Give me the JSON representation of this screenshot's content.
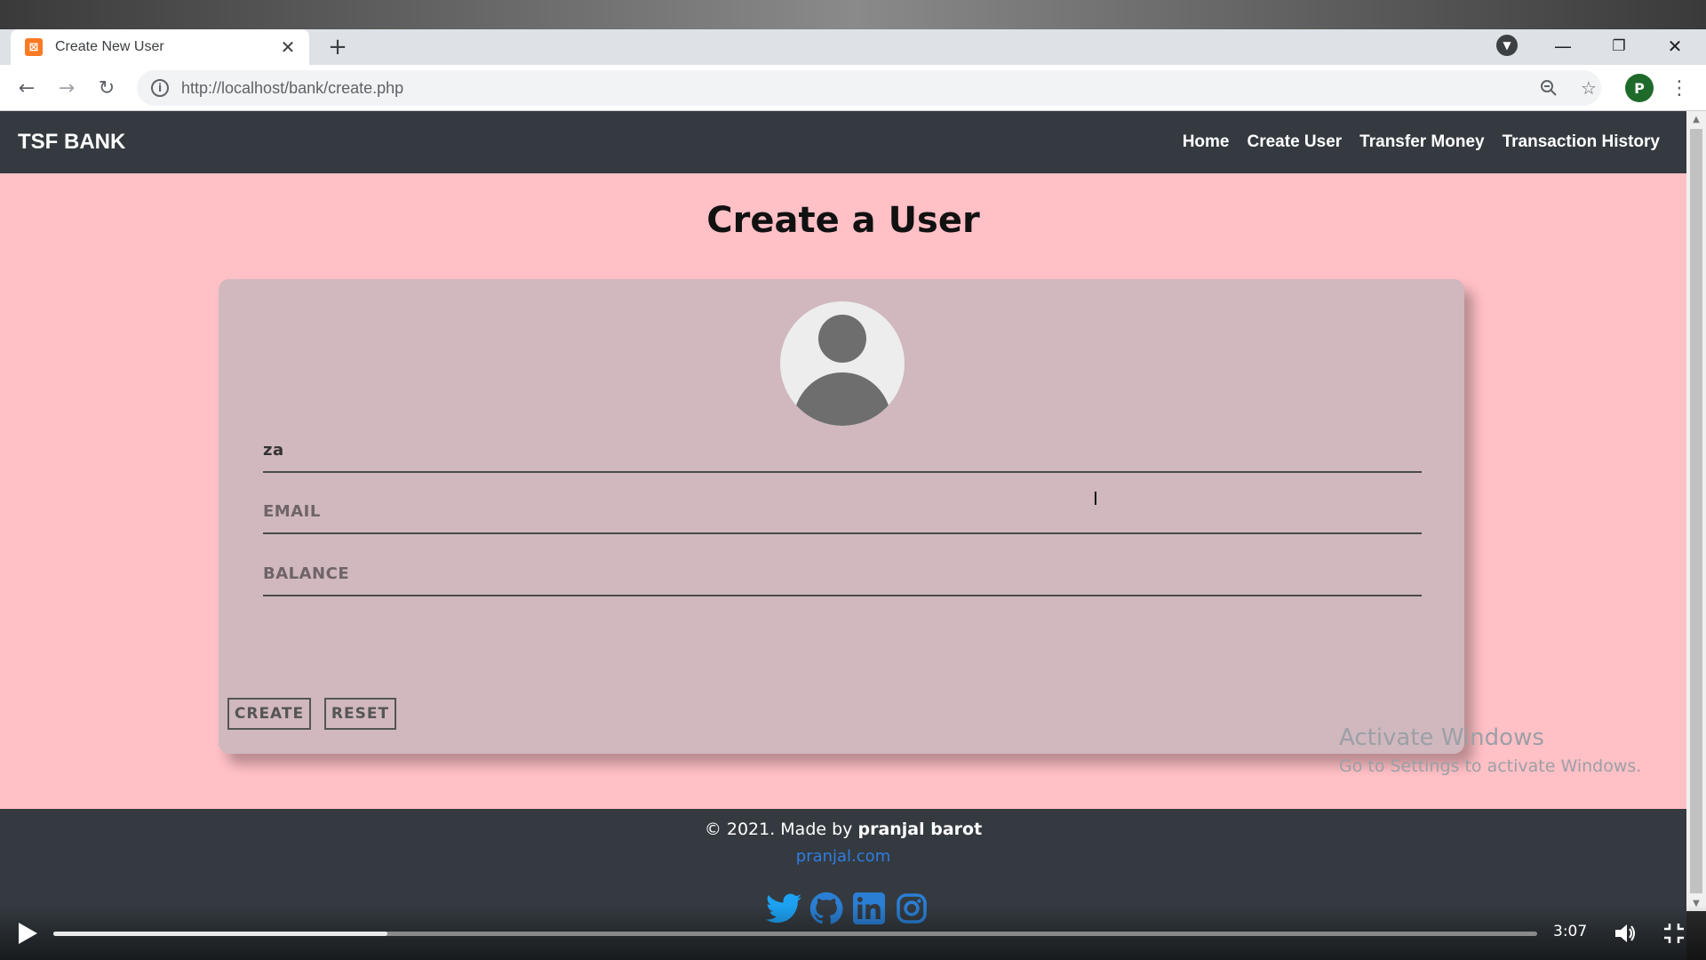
{
  "browser": {
    "tab_title": "Create New User",
    "url": "http://localhost/bank/create.php",
    "profile_initial": "P"
  },
  "navbar": {
    "brand": "TSF BANK",
    "links": [
      "Home",
      "Create User",
      "Transfer Money",
      "Transaction History"
    ]
  },
  "main": {
    "title": "Create a User",
    "form": {
      "name_value": "za",
      "email_placeholder": "EMAIL",
      "balance_placeholder": "BALANCE",
      "create_label": "CREATE",
      "reset_label": "RESET"
    }
  },
  "footer": {
    "copyright_prefix": "© 2021. Made by",
    "author": "pranjal barot",
    "site": "pranjal.com",
    "socials": [
      "twitter-icon",
      "github-icon",
      "linkedin-icon",
      "instagram-icon"
    ]
  },
  "watermark": {
    "line1": "Activate Windows",
    "line2": "Go to Settings to activate Windows."
  },
  "player": {
    "time": "3:07",
    "progress_fraction": 0.225
  },
  "colors": {
    "page_bg": "#ffc0c6",
    "navbar_bg": "#343a40",
    "card_bg": "#d0b8be",
    "link_blue": "#2f7de1"
  }
}
